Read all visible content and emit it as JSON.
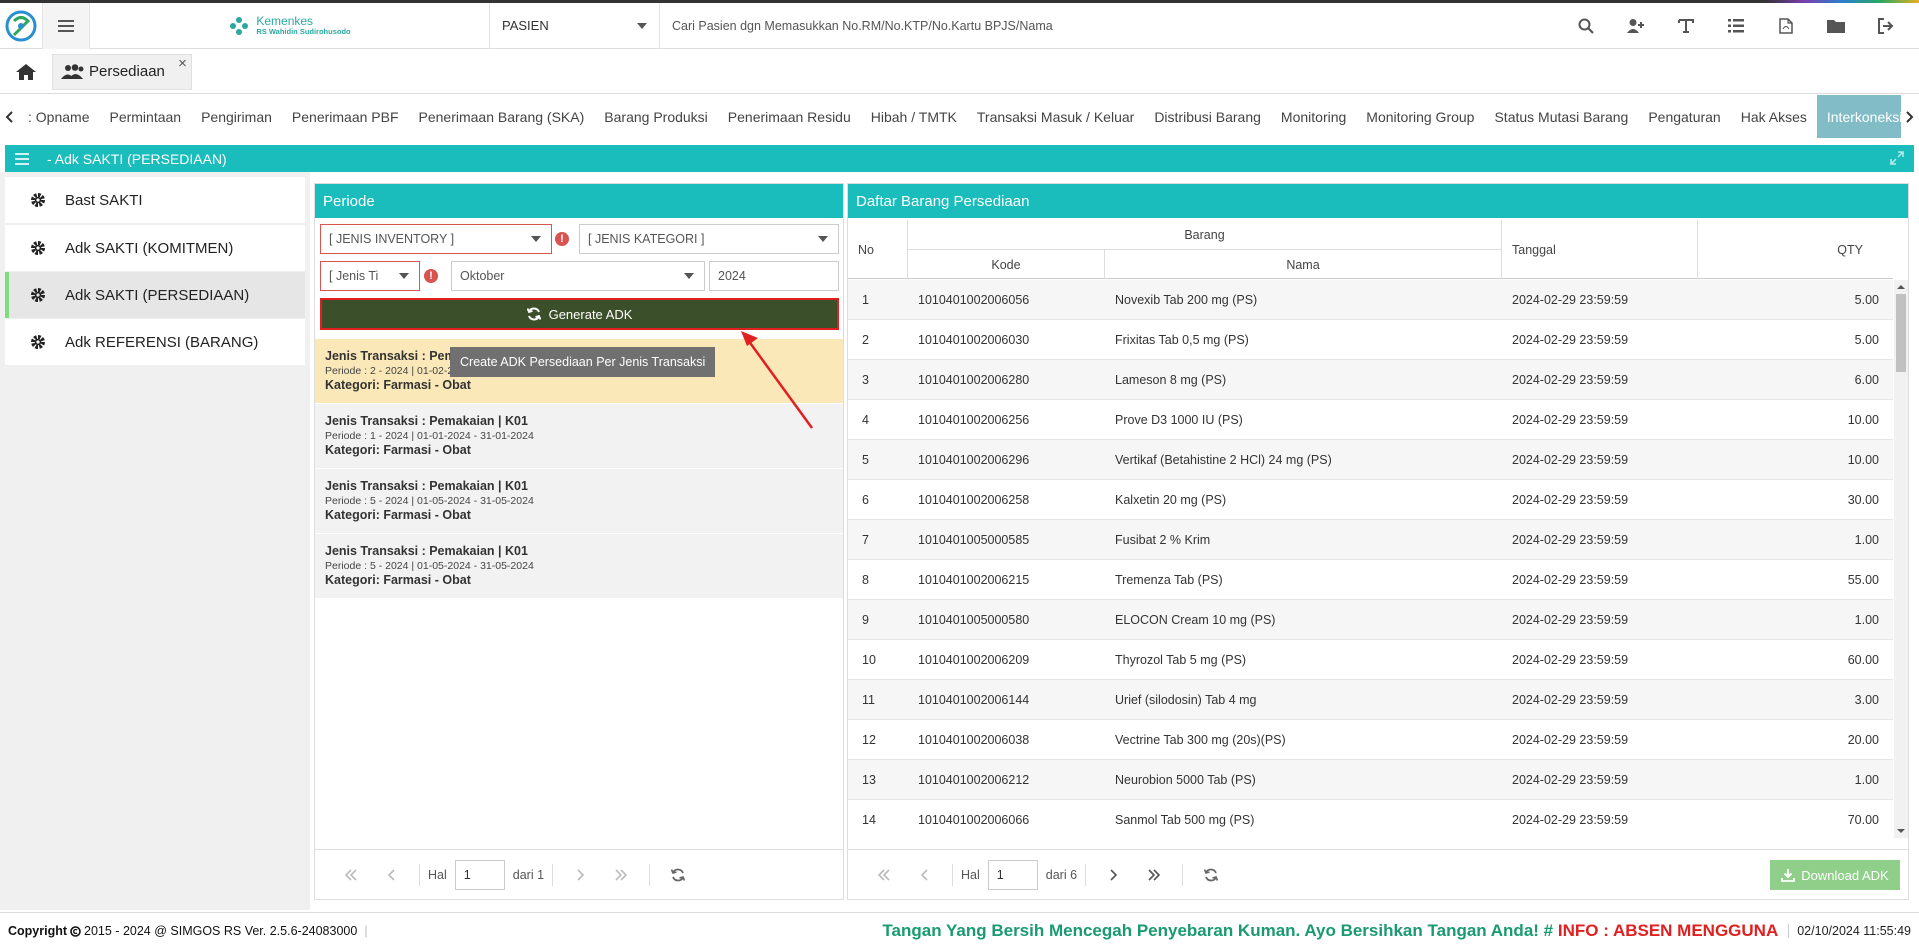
{
  "header": {
    "brand_main": "Kemenkes",
    "brand_sub": "RS Wahidin Sudirohusodo",
    "patient_select": "PASIEN",
    "search_placeholder": "Cari Pasien dgn Memasukkan No.RM/No.KTP/No.Kartu BPJS/Nama",
    "icons": [
      "search-icon",
      "user-plus-icon",
      "text-icon",
      "list-icon",
      "pdf-file-icon",
      "folder-icon",
      "sign-out-icon"
    ]
  },
  "tabs": {
    "page_tab": "Persediaan",
    "close": "×"
  },
  "modnav": {
    "items": [
      "Opname",
      "Permintaan",
      "Pengiriman",
      "Penerimaan PBF",
      "Penerimaan Barang (SKA)",
      "Barang Produksi",
      "Penerimaan Residu",
      "Hibah / TMTK",
      "Transaksi Masuk / Keluar",
      "Distribusi Barang",
      "Monitoring",
      "Monitoring Group",
      "Status Mutasi Barang",
      "Pengaturan",
      "Hak Akses",
      "Interkoneksi SAKTI"
    ],
    "first_prefix": ": ",
    "active": "Interkoneksi SAKTI"
  },
  "section": {
    "title": "- Adk SAKTI (PERSEDIAAN)"
  },
  "sidebar": {
    "items": [
      "Bast SAKTI",
      "Adk SAKTI (KOMITMEN)",
      "Adk SAKTI (PERSEDIAAN)",
      "Adk REFERENSI (BARANG)"
    ],
    "active": "Adk SAKTI (PERSEDIAAN)"
  },
  "periode": {
    "title": "Periode",
    "jenis_inventory": "[ JENIS INVENTORY ]",
    "jenis_kategori": "[ JENIS KATEGORI ]",
    "jenis_transaksi": "[ Jenis Ti",
    "bulan": "Oktober",
    "tahun": "2024",
    "error_mark": "!",
    "generate_label": "Generate ADK",
    "tooltip": "Create ADK Persediaan Per Jenis Transaksi",
    "transactions": [
      {
        "t1": "Jenis Transaksi : Pem",
        "t2": "Periode : 2 - 2024 | 01-02-2",
        "t3": "Kategori: Farmasi - Obat"
      },
      {
        "t1": "Jenis Transaksi : Pemakaian | K01",
        "t2": "Periode : 1 - 2024 | 01-01-2024 - 31-01-2024",
        "t3": "Kategori: Farmasi - Obat"
      },
      {
        "t1": "Jenis Transaksi : Pemakaian | K01",
        "t2": "Periode : 5 - 2024 | 01-05-2024 - 31-05-2024",
        "t3": "Kategori: Farmasi - Obat"
      },
      {
        "t1": "Jenis Transaksi : Pemakaian | K01",
        "t2": "Periode : 5 - 2024 | 01-05-2024 - 31-05-2024",
        "t3": "Kategori: Farmasi - Obat"
      }
    ],
    "pager": {
      "hal": "Hal",
      "page": "1",
      "dari": "dari 1"
    }
  },
  "table": {
    "title": "Daftar Barang Persediaan",
    "headers": {
      "no": "No",
      "barang": "Barang",
      "kode": "Kode",
      "nama": "Nama",
      "tanggal": "Tanggal",
      "qty": "QTY"
    },
    "rows": [
      {
        "no": "1",
        "kode": "1010401002006056",
        "nama": "Novexib Tab 200 mg (PS)",
        "tgl": "2024-02-29 23:59:59",
        "qty": "5.00"
      },
      {
        "no": "2",
        "kode": "1010401002006030",
        "nama": "Frixitas Tab 0,5 mg (PS)",
        "tgl": "2024-02-29 23:59:59",
        "qty": "5.00"
      },
      {
        "no": "3",
        "kode": "1010401002006280",
        "nama": "Lameson 8 mg (PS)",
        "tgl": "2024-02-29 23:59:59",
        "qty": "6.00"
      },
      {
        "no": "4",
        "kode": "1010401002006256",
        "nama": "Prove D3 1000 IU (PS)",
        "tgl": "2024-02-29 23:59:59",
        "qty": "10.00"
      },
      {
        "no": "5",
        "kode": "1010401002006296",
        "nama": "Vertikaf (Betahistine 2 HCl) 24 mg (PS)",
        "tgl": "2024-02-29 23:59:59",
        "qty": "10.00"
      },
      {
        "no": "6",
        "kode": "1010401002006258",
        "nama": "Kalxetin 20 mg (PS)",
        "tgl": "2024-02-29 23:59:59",
        "qty": "30.00"
      },
      {
        "no": "7",
        "kode": "1010401005000585",
        "nama": "Fusibat 2 % Krim",
        "tgl": "2024-02-29 23:59:59",
        "qty": "1.00"
      },
      {
        "no": "8",
        "kode": "1010401002006215",
        "nama": "Tremenza Tab (PS)",
        "tgl": "2024-02-29 23:59:59",
        "qty": "55.00"
      },
      {
        "no": "9",
        "kode": "1010401005000580",
        "nama": "ELOCON Cream 10 mg (PS)",
        "tgl": "2024-02-29 23:59:59",
        "qty": "1.00"
      },
      {
        "no": "10",
        "kode": "1010401002006209",
        "nama": "Thyrozol Tab 5 mg (PS)",
        "tgl": "2024-02-29 23:59:59",
        "qty": "60.00"
      },
      {
        "no": "11",
        "kode": "1010401002006144",
        "nama": "Urief (silodosin) Tab 4 mg",
        "tgl": "2024-02-29 23:59:59",
        "qty": "3.00"
      },
      {
        "no": "12",
        "kode": "1010401002006038",
        "nama": "Vectrine Tab 300 mg (20s)(PS)",
        "tgl": "2024-02-29 23:59:59",
        "qty": "20.00"
      },
      {
        "no": "13",
        "kode": "1010401002006212",
        "nama": "Neurobion 5000 Tab (PS)",
        "tgl": "2024-02-29 23:59:59",
        "qty": "1.00"
      },
      {
        "no": "14",
        "kode": "1010401002006066",
        "nama": "Sanmol Tab 500 mg (PS)",
        "tgl": "2024-02-29 23:59:59",
        "qty": "70.00"
      }
    ],
    "pager": {
      "hal": "Hal",
      "page": "1",
      "dari": "dari 6"
    },
    "download_label": "Download ADK"
  },
  "footer": {
    "copyright_label": "Copyright",
    "copyright_rest": "2015 - 2024 @ SIMGOS RS Ver. 2.5.6-24083000",
    "marquee_green": "Tangan Yang Bersih Mencegah Penyebaran Kuman. Ayo Bersihkan Tangan Anda! #",
    "marquee_red": "INFO : ABSEN MENGGUNA",
    "datetime": "02/10/2024 11:55:49"
  },
  "colors": {
    "teal": "#1abcbc",
    "generate_bg": "#3b4f2a",
    "highlight": "#e02020",
    "download_bg": "#8fcf8a"
  }
}
